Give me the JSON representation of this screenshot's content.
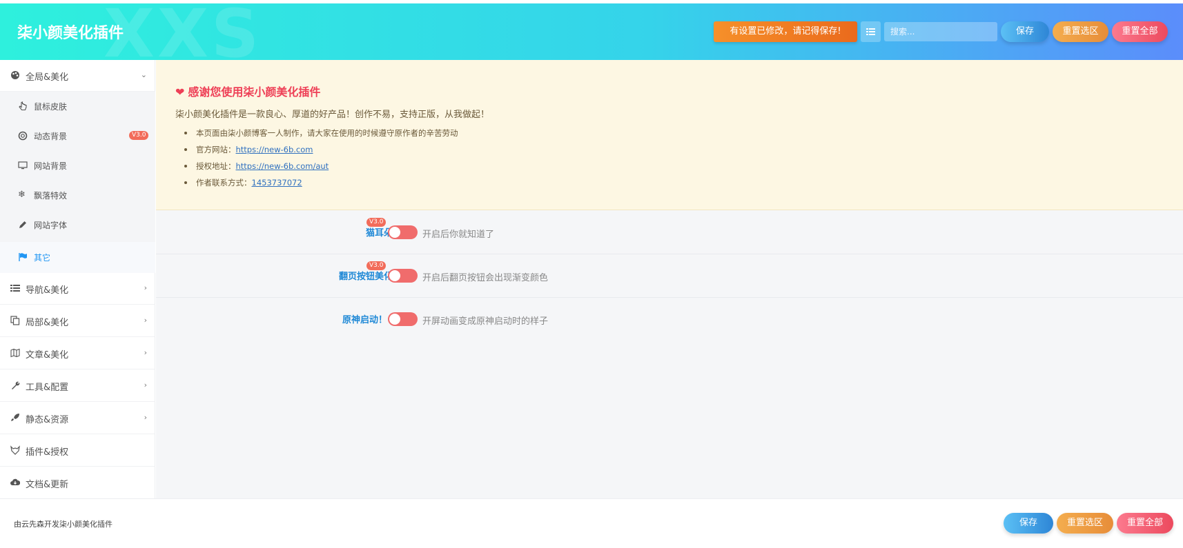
{
  "header": {
    "watermark": "XXS",
    "title": "柒小颜美化插件",
    "notice": "有设置已修改，请记得保存!",
    "search_placeholder": "搜索...",
    "save": "保存",
    "reset_section": "重置选区",
    "reset_all": "重置全部"
  },
  "sidebar": {
    "global": "全局&美化",
    "subs": {
      "cursor": "鼠标皮肤",
      "dynbg": "动态背景",
      "dynbg_badge": "V3.0",
      "sitebg": "网站背景",
      "falling": "飘落特效",
      "font": "网站字体",
      "other": "其它"
    },
    "nav": "导航&美化",
    "local": "局部&美化",
    "article": "文章&美化",
    "tools": "工具&配置",
    "static": "静态&资源",
    "plugin": "插件&授权",
    "docs": "文档&更新"
  },
  "thanks": {
    "title": "感谢您使用柒小颜美化插件",
    "subtitle": "柒小颜美化插件是一款良心、厚道的好产品！创作不易，支持正版，从我做起！",
    "line1": "本页面由柒小颜博客一人制作，请大家在使用的时候遵守原作者的辛苦劳动",
    "line2_prefix": "官方网站：",
    "line2_link": "https://new-6b.com",
    "line3_prefix": "授权地址：",
    "line3_link": "https://new-6b.com/aut",
    "line4_prefix": "作者联系方式：",
    "line4_link": "1453737072"
  },
  "options": [
    {
      "label": "猫耳朵",
      "badge": "V3.0",
      "desc": "开启后你就知道了",
      "enabled": false
    },
    {
      "label": "翻页按钮美化",
      "badge": "V3.0",
      "desc": "开启后翻页按钮会出现渐变颜色",
      "enabled": false
    },
    {
      "label": "原神启动！",
      "badge": "",
      "desc": "开屏动画变成原神启动时的样子",
      "enabled": false
    }
  ],
  "footer": {
    "credit": "由云先森开发柒小颜美化插件",
    "save": "保存",
    "reset_section": "重置选区",
    "reset_all": "重置全部"
  },
  "colors": {
    "accent": "#2196f3",
    "danger": "#ee3f56",
    "toggle_off": "#f06c6c"
  }
}
